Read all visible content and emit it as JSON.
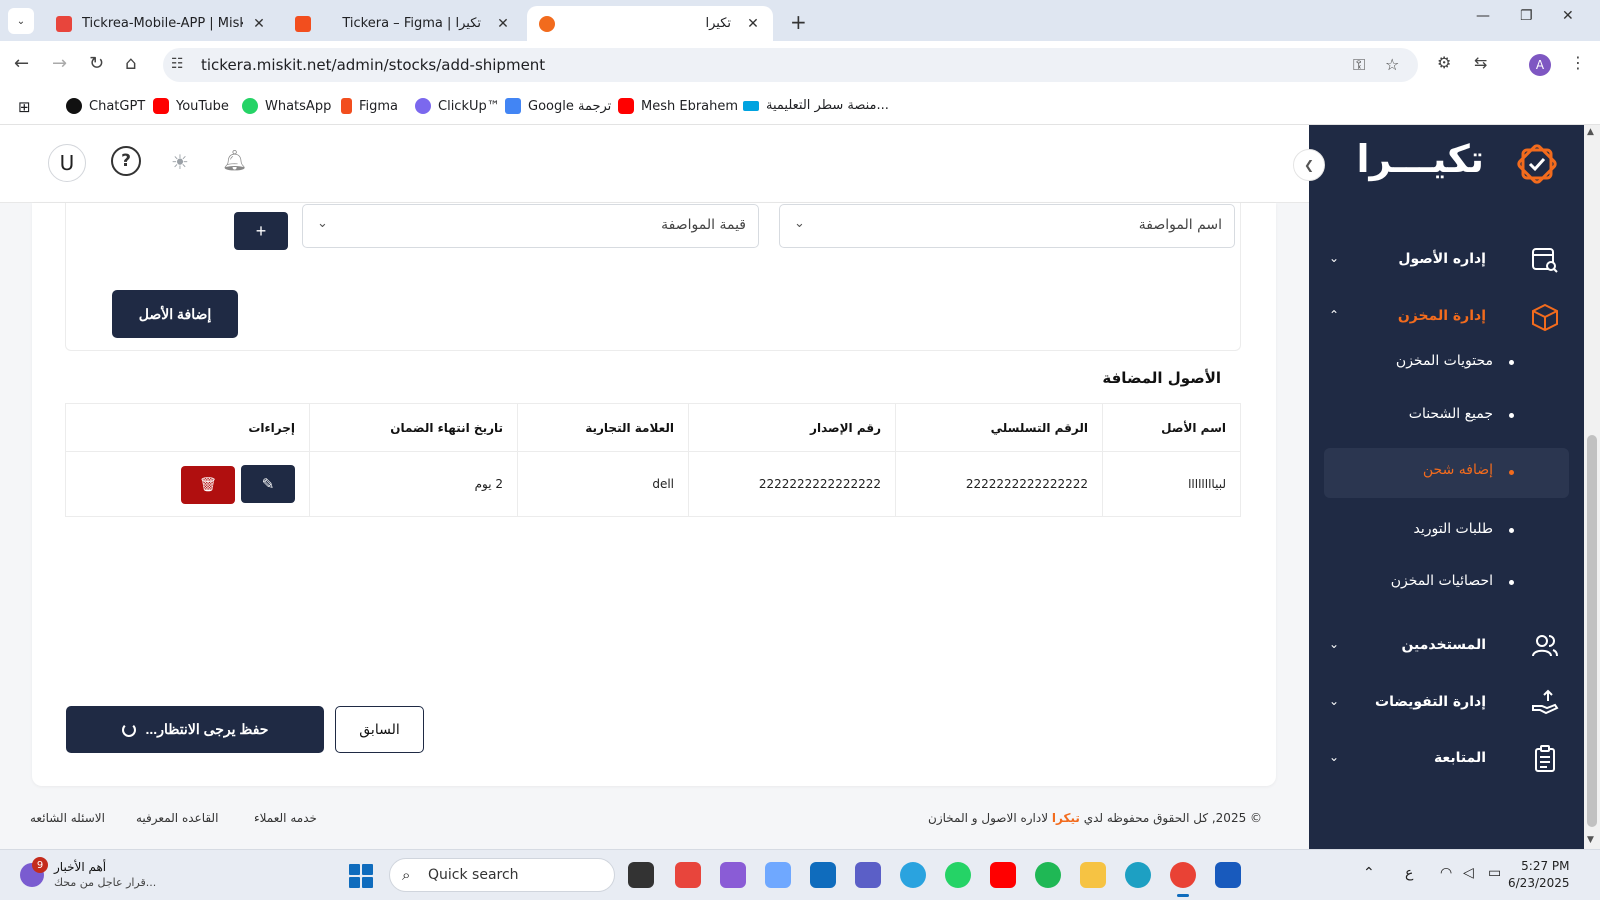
{
  "browser": {
    "tabs": [
      {
        "title": "Tickrea-Mobile-APP | Misk Integ"
      },
      {
        "title": "Tickera – Figma | تكيرا"
      },
      {
        "title": "تكيرا"
      }
    ],
    "new_tab": "+",
    "url": "tickera.miskit.net/admin/stocks/add-shipment",
    "profile_initial": "A",
    "bookmarks": [
      {
        "label": "ChatGPT",
        "color": "#111111"
      },
      {
        "label": "YouTube",
        "color": "#ff0000"
      },
      {
        "label": "WhatsApp",
        "color": "#25d366"
      },
      {
        "label": "Figma",
        "color": "#f24e1e"
      },
      {
        "label": "ClickUp™",
        "color": "#7b68ee"
      },
      {
        "label": "Google ترجمة",
        "color": "#4285f4"
      },
      {
        "label": "Mesh Ebrahem",
        "color": "#ff0000"
      },
      {
        "label": "منصة سطر التعليمية...",
        "color": "#00a3e0"
      }
    ]
  },
  "header": {
    "avatar_initial": "U",
    "help_symbol": "?",
    "theme_icon": "sun-icon",
    "notifications_icon": "bell-icon"
  },
  "form": {
    "spec_name_placeholder": "اسم المواصفة",
    "spec_value_placeholder": "قيمة المواصفة",
    "plus_label": "+",
    "add_asset_label": "إضافة الأصل"
  },
  "assets": {
    "title": "الأصول المضافة",
    "columns": [
      "اسم الأصل",
      "الرقم التسلسلي",
      "رقم الإصدار",
      "العلامة التجارية",
      "تاريخ انتهاء الضمان",
      "إجراءات"
    ],
    "rows": [
      {
        "name": "لبياااااااا",
        "serial": "2222222222222222",
        "version": "2222222222222222",
        "brand": "dell",
        "warranty": "2 يوم"
      }
    ]
  },
  "actions": {
    "save_label": "حفظ يرجى الانتظار...",
    "prev_label": "السابق"
  },
  "footer": {
    "copyright_prefix": "© 2025, كل الحقوق محفوظه لدي",
    "brand": "تيكرا",
    "copyright_suffix": "لاداره الاصول و المخازن",
    "links": [
      "خدمه العملاء",
      "القاعده المعرفيه",
      "الاسئله الشائعه"
    ]
  },
  "sidebar": {
    "logo_text": "تكيـــرا",
    "items": [
      {
        "label": "إداره الأصول",
        "icon": "asset-search-icon",
        "expanded": false
      },
      {
        "label": "إدارة المخزن",
        "icon": "box-icon",
        "expanded": true,
        "active": true
      },
      {
        "label": "المستخدمين",
        "icon": "users-icon",
        "expanded": false
      },
      {
        "label": "إدارة التفويضات",
        "icon": "hand-share-icon",
        "expanded": false
      },
      {
        "label": "المتابعة",
        "icon": "clipboard-icon",
        "expanded": false
      }
    ],
    "sub_items": [
      {
        "label": "محتويات المخزن"
      },
      {
        "label": "جميع الشحنات"
      },
      {
        "label": "إضافه شحن",
        "active": true
      },
      {
        "label": "طلبات التوريد"
      },
      {
        "label": "احصائيات المخزن"
      }
    ]
  },
  "taskbar": {
    "news_badge": "9",
    "news_title": "أهم الأخبار",
    "news_sub": "قرار عاجل من محك...",
    "search_placeholder": "Quick search",
    "lang": "ع",
    "time": "5:27 PM",
    "date": "6/23/2025"
  },
  "colors": {
    "primary": "#1f2a44",
    "accent": "#f26b1d",
    "danger": "#b00f0f"
  }
}
